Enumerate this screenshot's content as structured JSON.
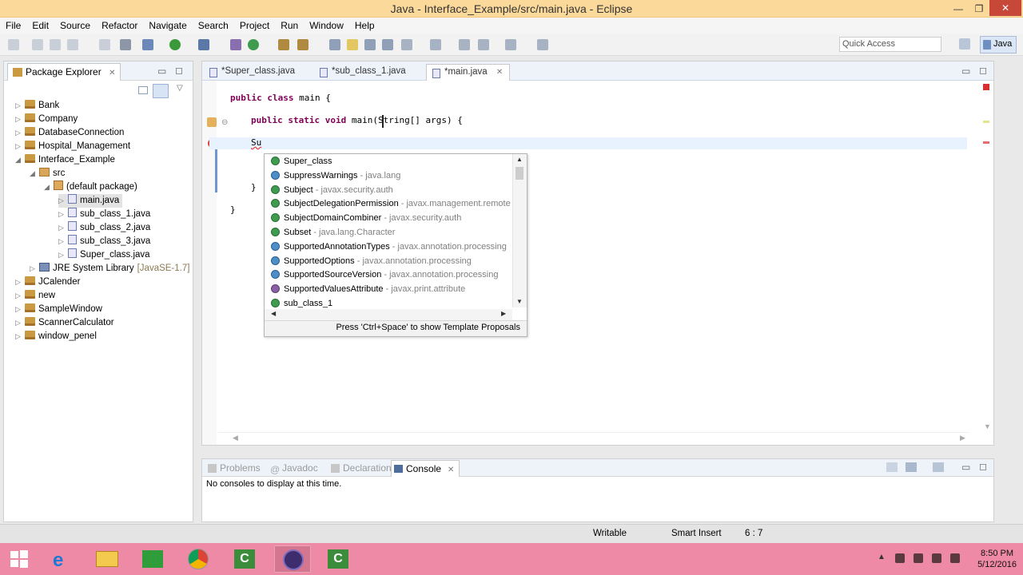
{
  "window": {
    "title": "Java - Interface_Example/src/main.java - Eclipse"
  },
  "menu": [
    "File",
    "Edit",
    "Source",
    "Refactor",
    "Navigate",
    "Search",
    "Project",
    "Run",
    "Window",
    "Help"
  ],
  "toolbar": {
    "quick_access": "Quick Access",
    "perspective": "Java"
  },
  "package_explorer": {
    "title": "Package Explorer",
    "items": [
      {
        "label": "Bank",
        "kind": "project",
        "level": 0
      },
      {
        "label": "Company",
        "kind": "project",
        "level": 0
      },
      {
        "label": "DatabaseConnection",
        "kind": "project",
        "level": 0
      },
      {
        "label": "Hospital_Management",
        "kind": "project",
        "level": 0
      },
      {
        "label": "Interface_Example",
        "kind": "project",
        "level": 0,
        "expanded": true
      },
      {
        "label": "src",
        "kind": "src",
        "level": 1,
        "expanded": true
      },
      {
        "label": "(default package)",
        "kind": "package",
        "level": 2,
        "expanded": true
      },
      {
        "label": "main.java",
        "kind": "java",
        "level": 3,
        "selected": true
      },
      {
        "label": "sub_class_1.java",
        "kind": "java",
        "level": 3
      },
      {
        "label": "sub_class_2.java",
        "kind": "java",
        "level": 3
      },
      {
        "label": "sub_class_3.java",
        "kind": "java",
        "level": 3
      },
      {
        "label": "Super_class.java",
        "kind": "java",
        "level": 3
      },
      {
        "label": "JRE System Library",
        "suffix": "[JavaSE-1.7]",
        "kind": "lib",
        "level": 1
      },
      {
        "label": "JCalender",
        "kind": "project",
        "level": 0
      },
      {
        "label": "new",
        "kind": "project",
        "level": 0
      },
      {
        "label": "SampleWindow",
        "kind": "project",
        "level": 0
      },
      {
        "label": "ScannerCalculator",
        "kind": "project",
        "level": 0
      },
      {
        "label": "window_penel",
        "kind": "project",
        "level": 0
      }
    ]
  },
  "editor": {
    "tabs": [
      {
        "label": "*Super_class.java"
      },
      {
        "label": "*sub_class_1.java"
      },
      {
        "label": "*main.java",
        "active": true
      }
    ],
    "code": {
      "line1_kw": "public class",
      "line1_rest": " main {",
      "line2_kw": "public static void",
      "line2_rest": " main(String[] args) {",
      "line3": "Su",
      "line4": "}",
      "line5": "}"
    }
  },
  "content_assist": {
    "items": [
      {
        "name": "Super_class",
        "pkg": "",
        "kind": "class"
      },
      {
        "name": "SuppressWarnings",
        "pkg": " - java.lang",
        "kind": "annotation"
      },
      {
        "name": "Subject",
        "pkg": " - javax.security.auth",
        "kind": "class"
      },
      {
        "name": "SubjectDelegationPermission",
        "pkg": " - javax.management.remote",
        "kind": "class"
      },
      {
        "name": "SubjectDomainCombiner",
        "pkg": " - javax.security.auth",
        "kind": "class"
      },
      {
        "name": "Subset",
        "pkg": " - java.lang.Character",
        "kind": "class"
      },
      {
        "name": "SupportedAnnotationTypes",
        "pkg": " - javax.annotation.processing",
        "kind": "annotation"
      },
      {
        "name": "SupportedOptions",
        "pkg": " - javax.annotation.processing",
        "kind": "annotation"
      },
      {
        "name": "SupportedSourceVersion",
        "pkg": " - javax.annotation.processing",
        "kind": "annotation"
      },
      {
        "name": "SupportedValuesAttribute",
        "pkg": " - javax.print.attribute",
        "kind": "interface"
      },
      {
        "name": "sub_class_1",
        "pkg": "",
        "kind": "class"
      }
    ],
    "footer": "Press 'Ctrl+Space' to show Template Proposals"
  },
  "console": {
    "tabs": [
      {
        "label": "Problems"
      },
      {
        "label": "Javadoc"
      },
      {
        "label": "Declaration"
      },
      {
        "label": "Console",
        "active": true
      }
    ],
    "message": "No consoles to display at this time."
  },
  "status": {
    "writable": "Writable",
    "insert_mode": "Smart Insert",
    "position": "6 : 7"
  },
  "taskbar": {
    "time": "8:50 PM",
    "date": "5/12/2016"
  }
}
